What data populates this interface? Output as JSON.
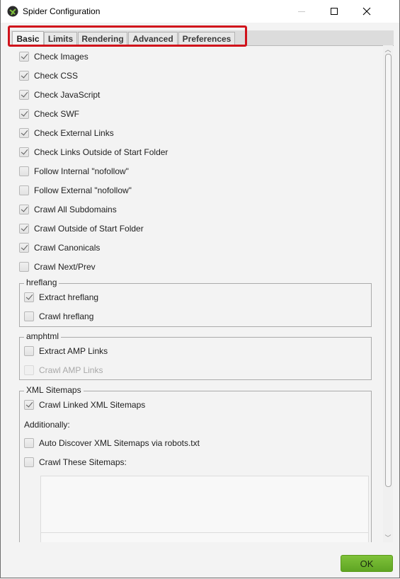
{
  "window": {
    "title": "Spider Configuration",
    "icon": "spider-icon",
    "controls": {
      "minimize": "minimize-icon",
      "maximize": "maximize-icon",
      "close": "close-icon",
      "close_glyph": "✕"
    }
  },
  "tabs": [
    {
      "label": "Basic",
      "active": true
    },
    {
      "label": "Limits",
      "active": false
    },
    {
      "label": "Rendering",
      "active": false
    },
    {
      "label": "Advanced",
      "active": false
    },
    {
      "label": "Preferences",
      "active": false
    }
  ],
  "highlight_color": "#d0121b",
  "options": [
    {
      "label": "Check Images",
      "checked": true
    },
    {
      "label": "Check CSS",
      "checked": true
    },
    {
      "label": "Check JavaScript",
      "checked": true
    },
    {
      "label": "Check SWF",
      "checked": true
    },
    {
      "label": "Check External Links",
      "checked": true
    },
    {
      "label": "Check Links Outside of Start Folder",
      "checked": true
    },
    {
      "label": "Follow Internal \"nofollow\"",
      "checked": false
    },
    {
      "label": "Follow External \"nofollow\"",
      "checked": false
    },
    {
      "label": "Crawl All Subdomains",
      "checked": true
    },
    {
      "label": "Crawl Outside of Start Folder",
      "checked": true
    },
    {
      "label": "Crawl Canonicals",
      "checked": true
    },
    {
      "label": "Crawl Next/Prev",
      "checked": false
    }
  ],
  "groups": {
    "hreflang": {
      "title": "hreflang",
      "options": [
        {
          "label": "Extract hreflang",
          "checked": true,
          "disabled": false
        },
        {
          "label": "Crawl hreflang",
          "checked": false,
          "disabled": false
        }
      ]
    },
    "amphtml": {
      "title": "amphtml",
      "options": [
        {
          "label": "Extract AMP Links",
          "checked": false,
          "disabled": false
        },
        {
          "label": "Crawl AMP Links",
          "checked": false,
          "disabled": true
        }
      ]
    },
    "xml_sitemaps": {
      "title": "XML Sitemaps",
      "crawl_linked": {
        "label": "Crawl Linked XML Sitemaps",
        "checked": true
      },
      "additionally_label": "Additionally:",
      "auto_discover": {
        "label": "Auto Discover XML Sitemaps via robots.txt",
        "checked": false
      },
      "crawl_these": {
        "label": "Crawl These Sitemaps:",
        "checked": false
      },
      "sitemaps_list_value": ""
    }
  },
  "scrollbar": {
    "up_glyph": "︿",
    "down_glyph": "﹀"
  },
  "footer": {
    "ok_label": "OK",
    "ok_color": "#6db22e"
  }
}
